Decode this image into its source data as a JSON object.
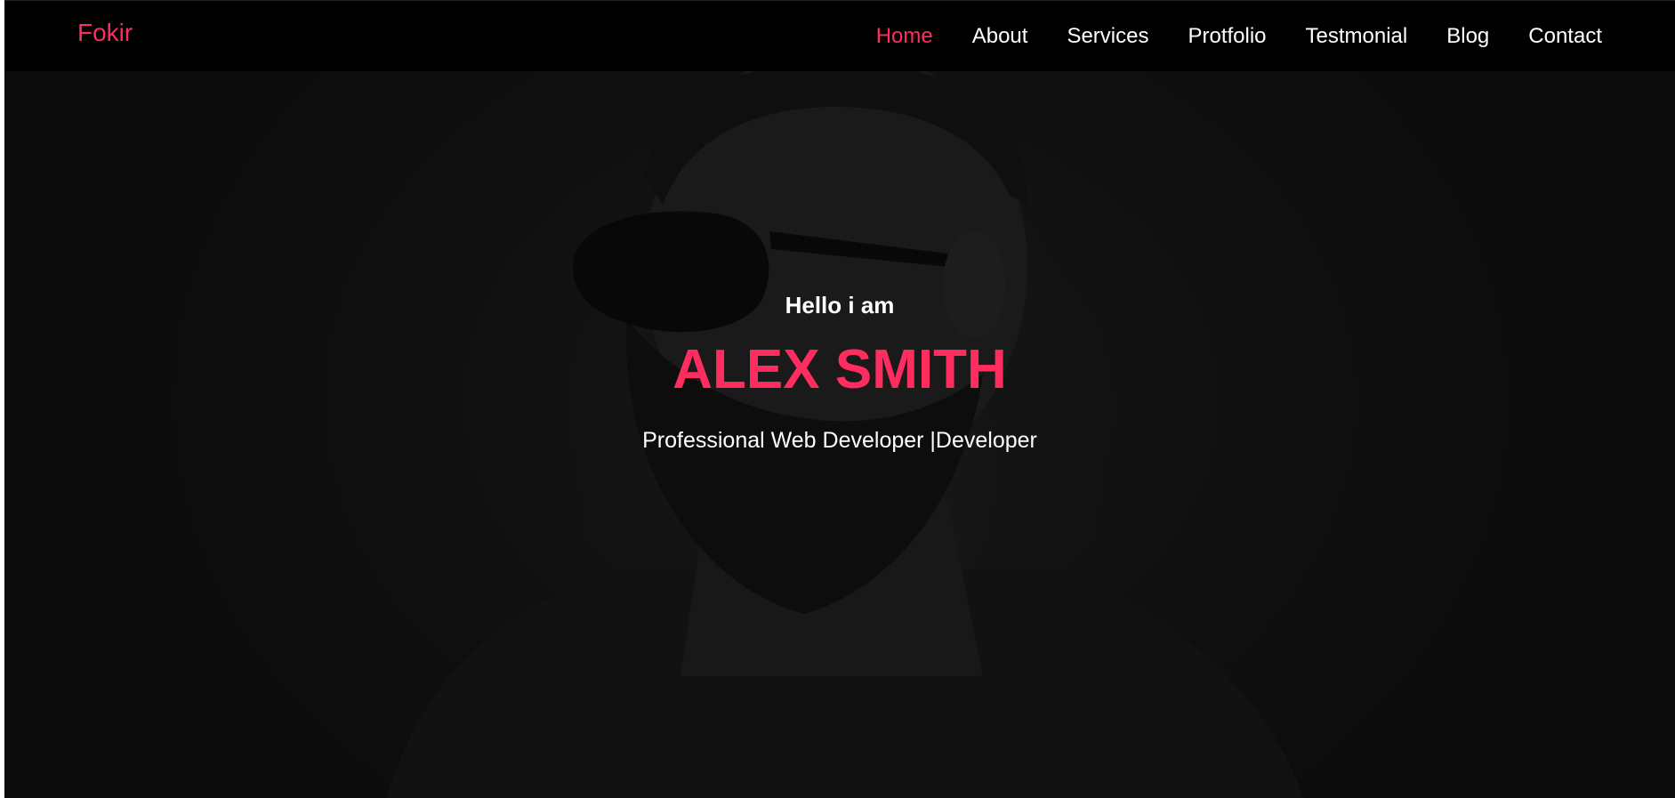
{
  "brand": {
    "name": "Fokir"
  },
  "nav": {
    "items": [
      {
        "label": "Home",
        "active": true
      },
      {
        "label": "About",
        "active": false
      },
      {
        "label": "Services",
        "active": false
      },
      {
        "label": "Protfolio",
        "active": false
      },
      {
        "label": "Testmonial",
        "active": false
      },
      {
        "label": "Blog",
        "active": false
      },
      {
        "label": "Contact",
        "active": false
      }
    ]
  },
  "hero": {
    "greeting": "Hello i am",
    "name": "ALEX SMITH",
    "tagline": "Professional Web Developer |Developer"
  },
  "colors": {
    "accent": "#ff2d5f",
    "background": "#000000",
    "text": "#ffffff"
  }
}
